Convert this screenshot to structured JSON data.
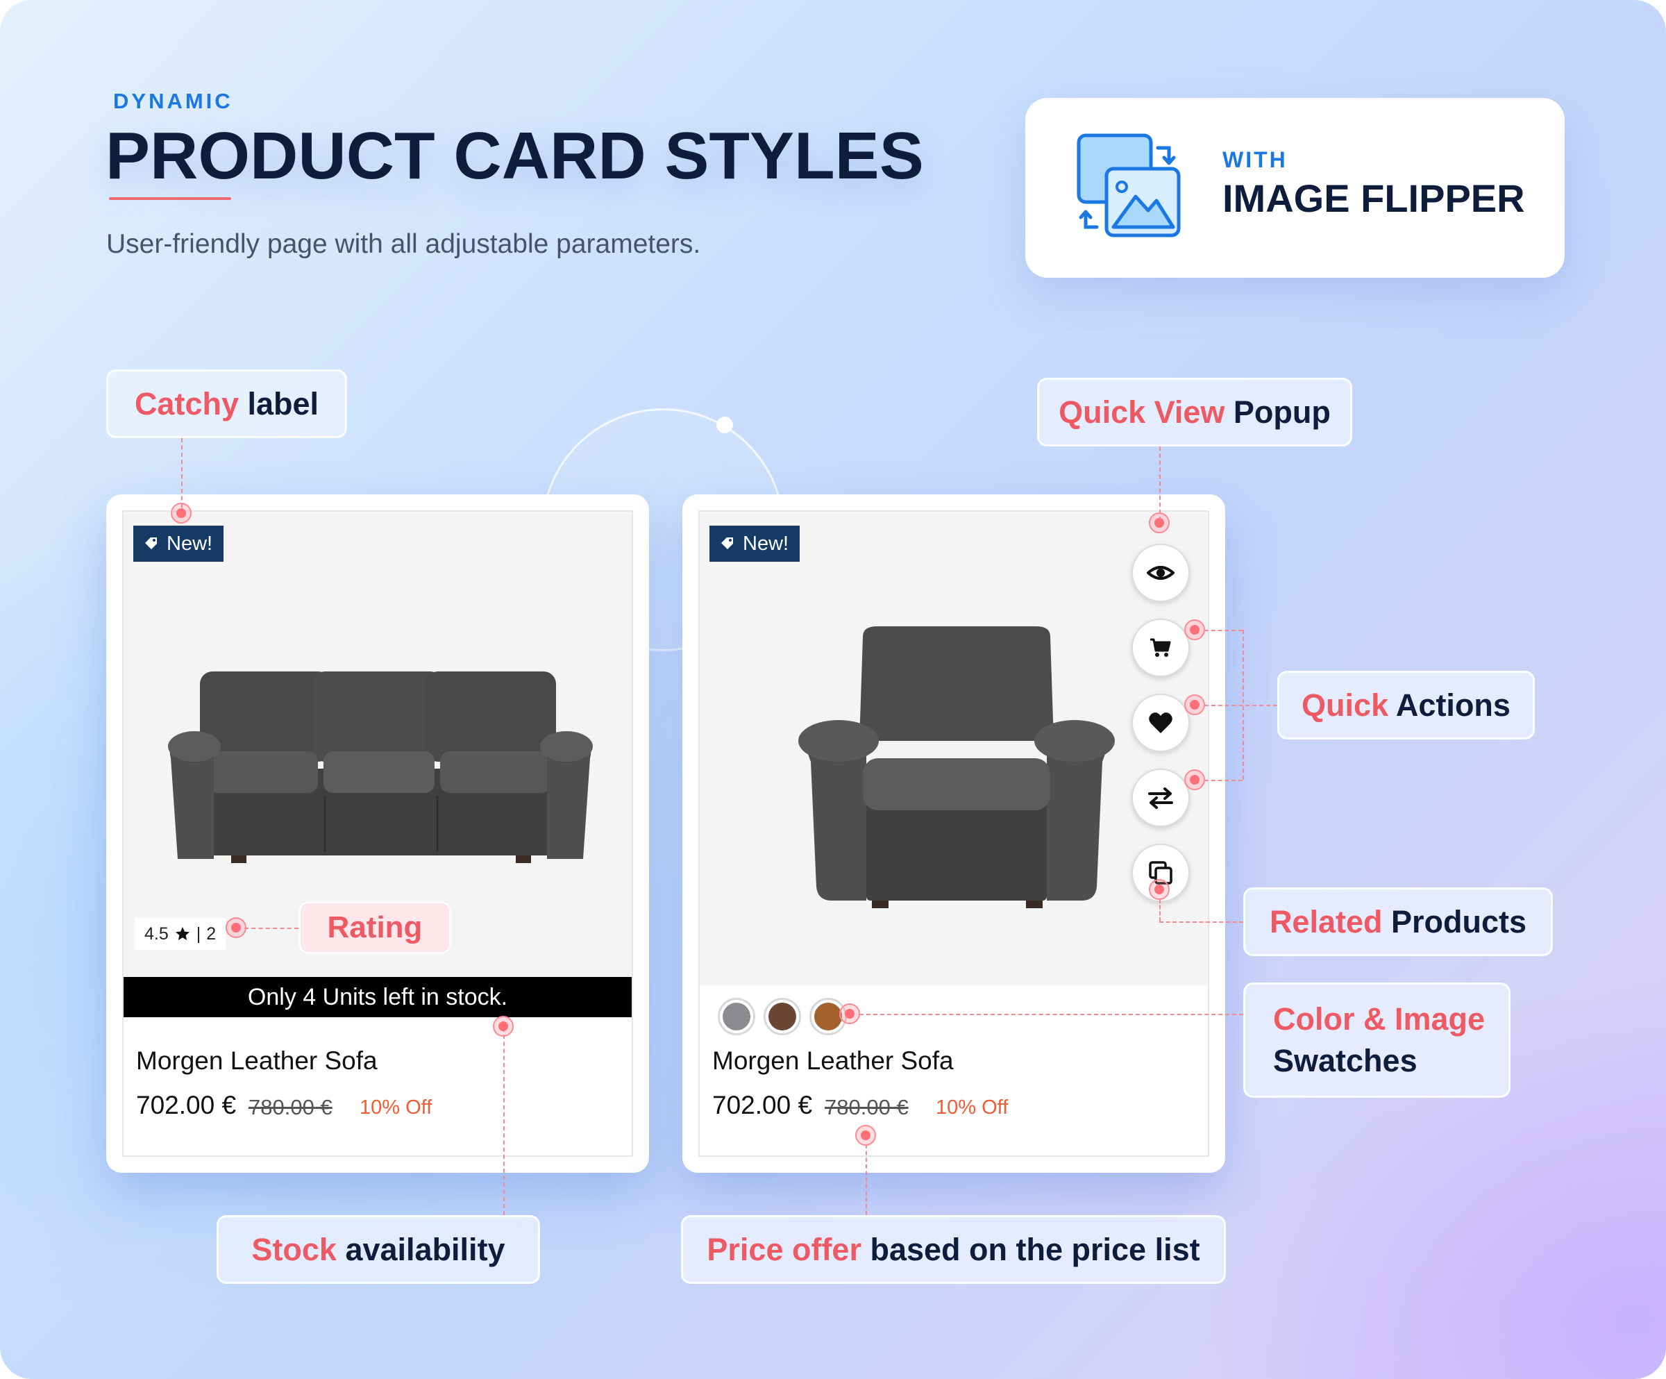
{
  "header": {
    "eyebrow": "DYNAMIC",
    "title": "PRODUCT CARD STYLES",
    "subtitle": "User-friendly page with all adjustable parameters."
  },
  "feature_badge": {
    "with": "WITH",
    "title": "IMAGE FLIPPER",
    "icon": "image-flip-icon"
  },
  "callouts": {
    "catchy_label": {
      "highlight": "Catchy",
      "rest": " label"
    },
    "rating": {
      "text": "Rating"
    },
    "stock": {
      "highlight": "Stock",
      "rest": " availability"
    },
    "quick_view": {
      "highlight": "Quick View",
      "rest": " Popup"
    },
    "quick_actions": {
      "highlight": "Quick",
      "rest": " Actions"
    },
    "related": {
      "highlight": "Related",
      "rest": " Products"
    },
    "swatches": {
      "highlight": "Color & Image",
      "rest": "Swatches"
    },
    "price_offer": {
      "highlight": "Price offer",
      "rest": " based on the price list"
    }
  },
  "cards": [
    {
      "label": "New!",
      "image": "leather-sofa-image",
      "rating": {
        "score": "4.5",
        "separator": "|",
        "count": "2"
      },
      "stock_text": "Only 4 Units left in stock.",
      "name": "Morgen Leather Sofa",
      "price": "702.00 €",
      "old_price": "780.00 €",
      "discount": "10% Off"
    },
    {
      "label": "New!",
      "image": "leather-armchair-image",
      "quick_actions": [
        "eye-icon",
        "cart-icon",
        "heart-icon",
        "compare-icon",
        "copy-icon"
      ],
      "swatches": [
        "#8a8c90",
        "#6b4634",
        "#a3612e"
      ],
      "name": "Morgen Leather Sofa",
      "price": "702.00 €",
      "old_price": "780.00 €",
      "discount": "10% Off"
    }
  ],
  "colors": {
    "accent_blue": "#1b78e2",
    "highlight_red": "#ee5a64",
    "title_navy": "#0f1d3c",
    "badge_navy": "#163a66",
    "discount_orange": "#f25b33"
  }
}
